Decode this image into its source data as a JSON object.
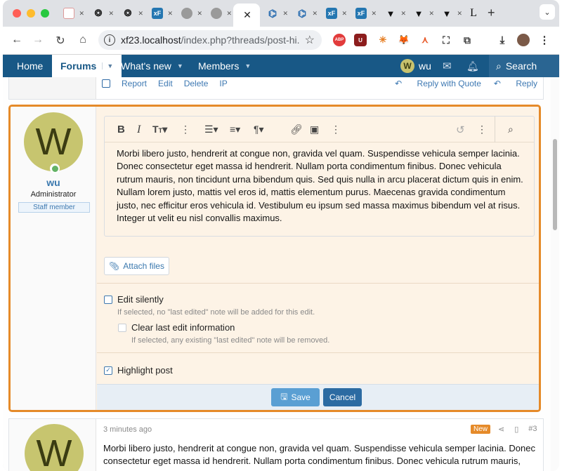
{
  "browser": {
    "tabs": [
      {
        "icon": "xf-spark-icon",
        "label": ""
      },
      {
        "icon": "openai-icon",
        "label": ""
      },
      {
        "icon": "openai-icon",
        "label": ""
      },
      {
        "icon": "xenforo-icon",
        "label": "xF"
      },
      {
        "icon": "globe-icon",
        "label": ""
      },
      {
        "icon": "globe-icon",
        "label": ""
      },
      {
        "icon": "copilot-icon",
        "label": ""
      },
      {
        "icon": "copilot-icon",
        "label": ""
      },
      {
        "icon": "xenforo-icon",
        "label": "xF"
      },
      {
        "icon": "xenforo-icon",
        "label": "xF"
      },
      {
        "icon": "wolf-icon",
        "label": ""
      },
      {
        "icon": "wolf-icon",
        "label": ""
      },
      {
        "icon": "wolf-icon",
        "label": ""
      },
      {
        "icon": "letter-l-icon",
        "label": "L"
      }
    ],
    "new_tab": "+",
    "url_host": "xf23.localhost",
    "url_path": "/index.php?threads/post-hi..."
  },
  "nav": {
    "home": "Home",
    "forums": "Forums",
    "whats_new": "What's new",
    "members": "Members",
    "user_initial": "W",
    "user_name": "wu",
    "search": "Search"
  },
  "prev_post": {
    "actions": [
      "Report",
      "Edit",
      "Delete",
      "IP"
    ],
    "reply_quote": "Reply with Quote",
    "reply": "Reply"
  },
  "edit_post": {
    "avatar_initial": "W",
    "username": "wu",
    "user_title": "Administrator",
    "user_banner": "Staff member",
    "body": "Morbi libero justo, hendrerit at congue non, gravida vel quam. Suspendisse vehicula semper lacinia. Donec consectetur eget massa id hendrerit. Nullam porta condimentum finibus. Donec vehicula rutrum mauris, non tincidunt urna bibendum quis. Sed quis nulla in arcu placerat dictum quis in enim. Nullam lorem justo, mattis vel eros id, mattis elementum purus. Maecenas gravida condimentum justo, nec efficitur eros vehicula id. Vestibulum eu ipsum sed massa maximus bibendum vel at risus. Integer ut velit eu nisl convallis maximus.",
    "attach_label": "Attach files",
    "edit_silently": "Edit silently",
    "edit_silently_hint": "If selected, no \"last edited\" note will be added for this edit.",
    "clear_last_edit": "Clear last edit information",
    "clear_last_edit_hint": "If selected, any existing \"last edited\" note will be removed.",
    "highlight_post": "Highlight post",
    "highlight_checked": true,
    "save": "Save",
    "cancel": "Cancel"
  },
  "next_post": {
    "avatar_initial": "W",
    "time": "3 minutes ago",
    "badge": "New",
    "number": "#3",
    "body": "Morbi libero justo, hendrerit at congue non, gravida vel quam. Suspendisse vehicula semper lacinia. Donec consectetur eget massa id hendrerit. Nullam porta condimentum finibus. Donec vehicula rutrum mauris,"
  },
  "colors": {
    "nav_bg": "#185886",
    "edit_border": "#e58a29",
    "edit_bg": "#fdf3e6",
    "link": "#3a78ae"
  }
}
